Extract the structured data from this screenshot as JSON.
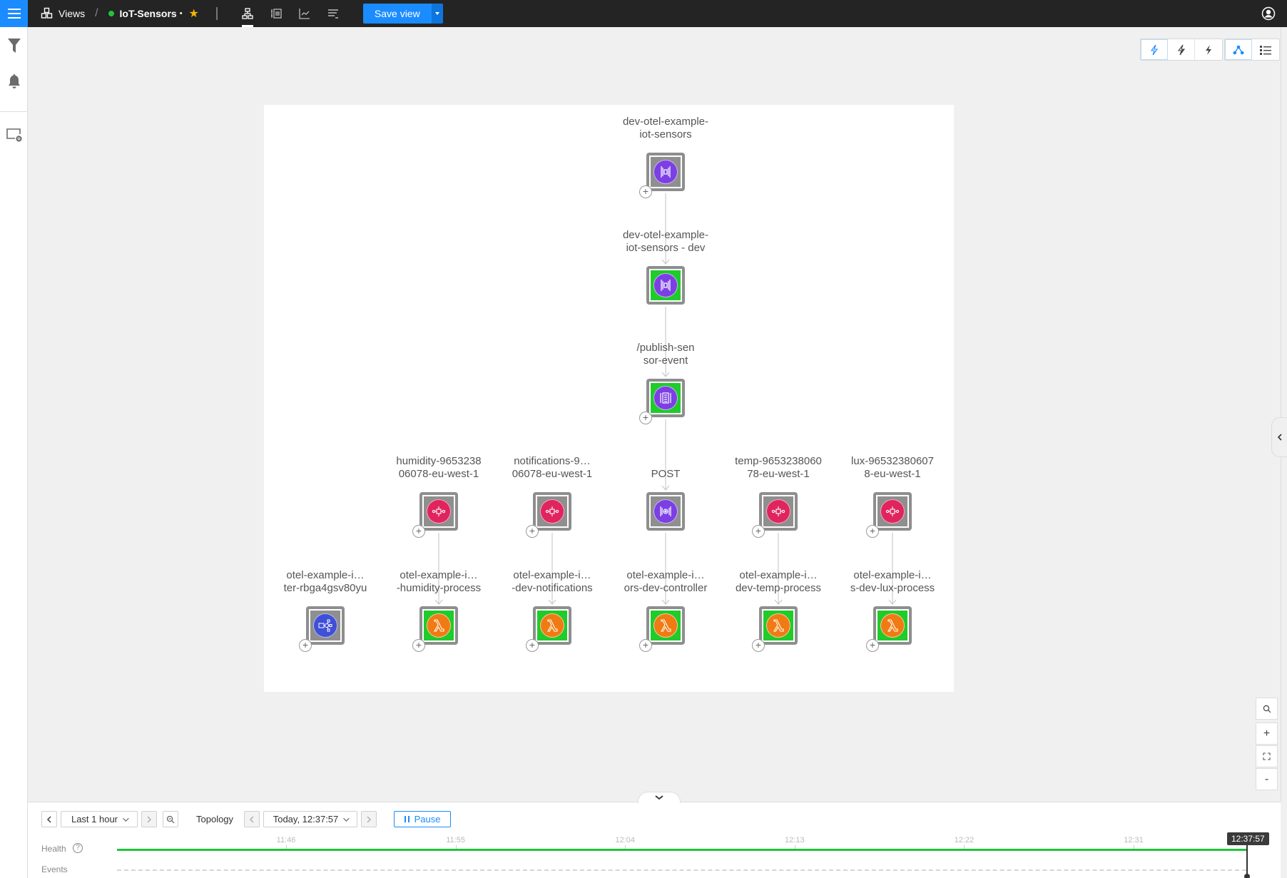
{
  "topbar": {
    "breadcrumb_root": "Views",
    "view_title": "IoT-Sensors",
    "modified_marker": "•",
    "status_color": "#22c33a",
    "save_view_label": "Save view",
    "view_tabs": [
      {
        "name": "topology-view-tab",
        "active": true
      },
      {
        "name": "components-list-tab",
        "active": false
      },
      {
        "name": "telemetry-chart-tab",
        "active": false
      },
      {
        "name": "events-tab",
        "active": false
      }
    ]
  },
  "sidebar": {
    "items": [
      {
        "name": "filter",
        "icon": "funnel-icon"
      },
      {
        "name": "notifications",
        "icon": "bell-icon"
      },
      {
        "name": "view-settings",
        "icon": "screen-gear-icon"
      }
    ]
  },
  "right_toolbar": {
    "buttons": [
      {
        "name": "root-cause-low",
        "icon": "lightning-outline-icon",
        "selected": true
      },
      {
        "name": "root-cause-medium",
        "icon": "lightning-half-icon",
        "selected": false
      },
      {
        "name": "root-cause-full",
        "icon": "lightning-solid-icon",
        "selected": false
      },
      {
        "name": "graph-view",
        "icon": "graph-nodes-icon",
        "selected": true
      },
      {
        "name": "list-view",
        "icon": "list-icon",
        "selected": false
      }
    ]
  },
  "topology": {
    "nodes": [
      {
        "id": "n1",
        "line1": "dev-otel-example-",
        "line2": "iot-sensors",
        "type": "api-gateway",
        "health": "unknown",
        "plus": true
      },
      {
        "id": "n2",
        "line1": "dev-otel-example-",
        "line2": "iot-sensors - dev",
        "type": "api-gateway",
        "health": "clear",
        "plus": false
      },
      {
        "id": "n3",
        "line1": "/publish-sen",
        "line2": "sor-event",
        "type": "api-resource",
        "health": "clear",
        "plus": true
      },
      {
        "id": "n4",
        "line1": "humidity-9653238",
        "line2": "06078-eu-west-1",
        "type": "sqs-queue",
        "health": "unknown",
        "plus": true
      },
      {
        "id": "n5",
        "line1": "notifications-9…",
        "line2": "06078-eu-west-1",
        "type": "sqs-queue",
        "health": "unknown",
        "plus": true
      },
      {
        "id": "n6",
        "line1": "",
        "line2": "POST",
        "type": "api-method",
        "health": "unknown",
        "plus": false
      },
      {
        "id": "n7",
        "line1": "temp-9653238060",
        "line2": "78-eu-west-1",
        "type": "sqs-queue",
        "health": "unknown",
        "plus": true
      },
      {
        "id": "n8",
        "line1": "lux-96532380607",
        "line2": "8-eu-west-1",
        "type": "sqs-queue",
        "health": "unknown",
        "plus": true
      },
      {
        "id": "n9",
        "line1": "otel-example-i…",
        "line2": "ter-rbga4gsv80yu",
        "type": "step-functions",
        "health": "unknown",
        "plus": true
      },
      {
        "id": "n10",
        "line1": "otel-example-i…",
        "line2": "-humidity-process",
        "type": "lambda",
        "health": "clear",
        "plus": true
      },
      {
        "id": "n11",
        "line1": "otel-example-i…",
        "line2": "-dev-notifications",
        "type": "lambda",
        "health": "clear",
        "plus": true
      },
      {
        "id": "n12",
        "line1": "otel-example-i…",
        "line2": "ors-dev-controller",
        "type": "lambda",
        "health": "clear",
        "plus": true
      },
      {
        "id": "n13",
        "line1": "otel-example-i…",
        "line2": "dev-temp-process",
        "type": "lambda",
        "health": "clear",
        "plus": true
      },
      {
        "id": "n14",
        "line1": "otel-example-i…",
        "line2": "s-dev-lux-process",
        "type": "lambda",
        "health": "clear",
        "plus": true
      }
    ],
    "edges": [
      [
        "n1",
        "n2"
      ],
      [
        "n2",
        "n3"
      ],
      [
        "n3",
        "n6"
      ],
      [
        "n6",
        "n12"
      ],
      [
        "n4",
        "n10"
      ],
      [
        "n5",
        "n11"
      ],
      [
        "n7",
        "n13"
      ],
      [
        "n8",
        "n14"
      ]
    ],
    "colors": {
      "health_clear": "#1fcc2a",
      "health_unknown": "#8f8f8f",
      "api": "#7b3fe4",
      "sqs": "#e0245e",
      "lambda": "#f07b12",
      "step": "#3f4fd8"
    }
  },
  "zoom_controls": [
    "search",
    "zoom-in",
    "fit",
    "zoom-out"
  ],
  "timeline": {
    "range_label": "Last 1 hour",
    "topology_label": "Topology",
    "time_label": "Today, 12:37:57",
    "pause_label": "Pause",
    "health_label": "Health",
    "events_label": "Events",
    "help_glyph": "?",
    "ticks": [
      "11:46",
      "11:55",
      "12:04",
      "12:13",
      "12:22",
      "12:31"
    ],
    "cursor_time": "12:37:57",
    "health_state": "clear"
  }
}
